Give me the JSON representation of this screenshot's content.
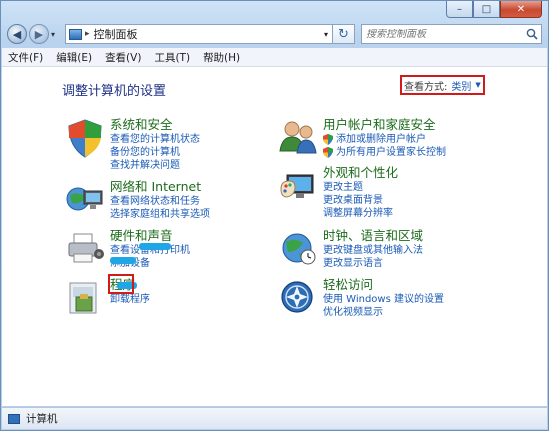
{
  "window": {
    "minimize": "–",
    "maximize": "□",
    "close": "✕"
  },
  "nav": {
    "back": "◀",
    "forward": "▶",
    "history": "▾",
    "breadcrumb_sep": "▸",
    "address": "控制面板",
    "address_dd": "▾",
    "refresh": "↻",
    "search_placeholder": "搜索控制面板"
  },
  "menu": [
    "文件(F)",
    "编辑(E)",
    "查看(V)",
    "工具(T)",
    "帮助(H)"
  ],
  "page": {
    "heading": "调整计算机的设置"
  },
  "view_by": {
    "label": "查看方式:",
    "value": "类别",
    "arrow": "▼"
  },
  "categories": {
    "system": {
      "title": "系统和安全",
      "links": [
        "查看您的计算机状态",
        "备份您的计算机",
        "查找并解决问题"
      ]
    },
    "network": {
      "title": "网络和 Internet",
      "links": [
        "查看网络状态和任务",
        "选择家庭组和共享选项"
      ]
    },
    "hardware": {
      "title": "硬件和声音",
      "links": [
        "查看设备和打印机",
        "添加设备"
      ]
    },
    "programs": {
      "title": "程序",
      "links": [
        "卸载程序"
      ]
    },
    "users": {
      "title": "用户帐户和家庭安全",
      "links": [
        "添加或删除用户帐户",
        "为所有用户设置家长控制"
      ]
    },
    "appearance": {
      "title": "外观和个性化",
      "links": [
        "更改主题",
        "更改桌面背景",
        "调整屏幕分辨率"
      ]
    },
    "clock": {
      "title": "时钟、语言和区域",
      "links": [
        "更改键盘或其他输入法",
        "更改显示语言"
      ]
    },
    "ease": {
      "title": "轻松访问",
      "links": [
        "使用 Windows 建议的设置",
        "优化视频显示"
      ]
    }
  },
  "status": {
    "text": "计算机"
  },
  "colors": {
    "title_green": "#1b6b1b",
    "link_blue": "#1a5ab5",
    "highlight_red": "#d11a1a",
    "heading_blue": "#1e3287"
  }
}
